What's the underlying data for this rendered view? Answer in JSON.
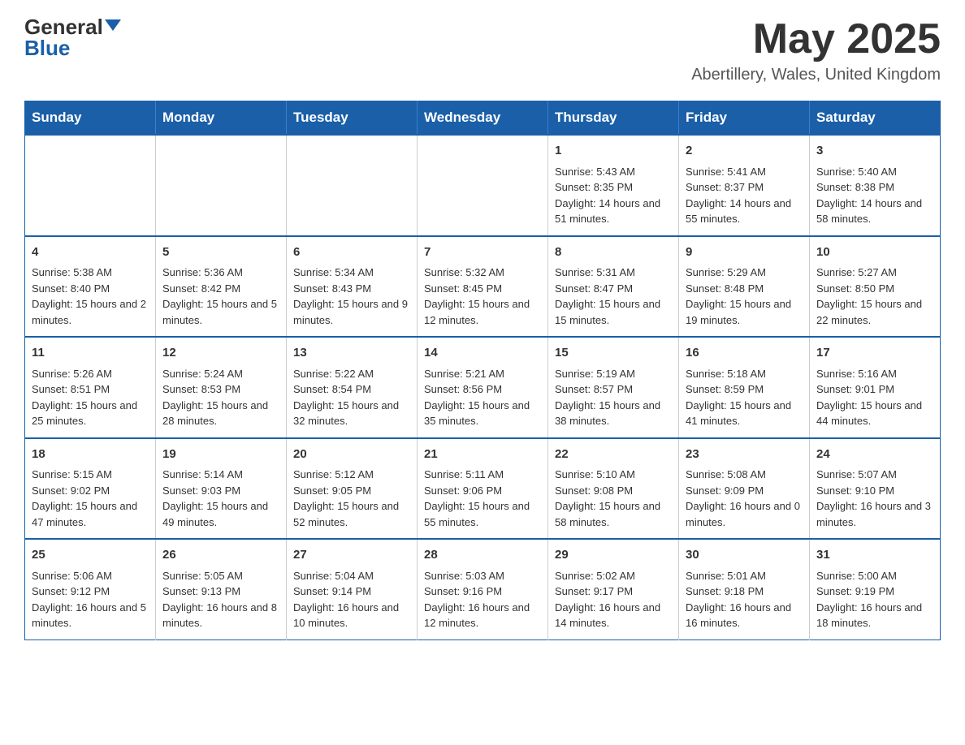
{
  "logo": {
    "general": "General",
    "blue": "Blue"
  },
  "title": "May 2025",
  "location": "Abertillery, Wales, United Kingdom",
  "days_of_week": [
    "Sunday",
    "Monday",
    "Tuesday",
    "Wednesday",
    "Thursday",
    "Friday",
    "Saturday"
  ],
  "weeks": [
    [
      {
        "day": "",
        "info": ""
      },
      {
        "day": "",
        "info": ""
      },
      {
        "day": "",
        "info": ""
      },
      {
        "day": "",
        "info": ""
      },
      {
        "day": "1",
        "info": "Sunrise: 5:43 AM\nSunset: 8:35 PM\nDaylight: 14 hours and 51 minutes."
      },
      {
        "day": "2",
        "info": "Sunrise: 5:41 AM\nSunset: 8:37 PM\nDaylight: 14 hours and 55 minutes."
      },
      {
        "day": "3",
        "info": "Sunrise: 5:40 AM\nSunset: 8:38 PM\nDaylight: 14 hours and 58 minutes."
      }
    ],
    [
      {
        "day": "4",
        "info": "Sunrise: 5:38 AM\nSunset: 8:40 PM\nDaylight: 15 hours and 2 minutes."
      },
      {
        "day": "5",
        "info": "Sunrise: 5:36 AM\nSunset: 8:42 PM\nDaylight: 15 hours and 5 minutes."
      },
      {
        "day": "6",
        "info": "Sunrise: 5:34 AM\nSunset: 8:43 PM\nDaylight: 15 hours and 9 minutes."
      },
      {
        "day": "7",
        "info": "Sunrise: 5:32 AM\nSunset: 8:45 PM\nDaylight: 15 hours and 12 minutes."
      },
      {
        "day": "8",
        "info": "Sunrise: 5:31 AM\nSunset: 8:47 PM\nDaylight: 15 hours and 15 minutes."
      },
      {
        "day": "9",
        "info": "Sunrise: 5:29 AM\nSunset: 8:48 PM\nDaylight: 15 hours and 19 minutes."
      },
      {
        "day": "10",
        "info": "Sunrise: 5:27 AM\nSunset: 8:50 PM\nDaylight: 15 hours and 22 minutes."
      }
    ],
    [
      {
        "day": "11",
        "info": "Sunrise: 5:26 AM\nSunset: 8:51 PM\nDaylight: 15 hours and 25 minutes."
      },
      {
        "day": "12",
        "info": "Sunrise: 5:24 AM\nSunset: 8:53 PM\nDaylight: 15 hours and 28 minutes."
      },
      {
        "day": "13",
        "info": "Sunrise: 5:22 AM\nSunset: 8:54 PM\nDaylight: 15 hours and 32 minutes."
      },
      {
        "day": "14",
        "info": "Sunrise: 5:21 AM\nSunset: 8:56 PM\nDaylight: 15 hours and 35 minutes."
      },
      {
        "day": "15",
        "info": "Sunrise: 5:19 AM\nSunset: 8:57 PM\nDaylight: 15 hours and 38 minutes."
      },
      {
        "day": "16",
        "info": "Sunrise: 5:18 AM\nSunset: 8:59 PM\nDaylight: 15 hours and 41 minutes."
      },
      {
        "day": "17",
        "info": "Sunrise: 5:16 AM\nSunset: 9:01 PM\nDaylight: 15 hours and 44 minutes."
      }
    ],
    [
      {
        "day": "18",
        "info": "Sunrise: 5:15 AM\nSunset: 9:02 PM\nDaylight: 15 hours and 47 minutes."
      },
      {
        "day": "19",
        "info": "Sunrise: 5:14 AM\nSunset: 9:03 PM\nDaylight: 15 hours and 49 minutes."
      },
      {
        "day": "20",
        "info": "Sunrise: 5:12 AM\nSunset: 9:05 PM\nDaylight: 15 hours and 52 minutes."
      },
      {
        "day": "21",
        "info": "Sunrise: 5:11 AM\nSunset: 9:06 PM\nDaylight: 15 hours and 55 minutes."
      },
      {
        "day": "22",
        "info": "Sunrise: 5:10 AM\nSunset: 9:08 PM\nDaylight: 15 hours and 58 minutes."
      },
      {
        "day": "23",
        "info": "Sunrise: 5:08 AM\nSunset: 9:09 PM\nDaylight: 16 hours and 0 minutes."
      },
      {
        "day": "24",
        "info": "Sunrise: 5:07 AM\nSunset: 9:10 PM\nDaylight: 16 hours and 3 minutes."
      }
    ],
    [
      {
        "day": "25",
        "info": "Sunrise: 5:06 AM\nSunset: 9:12 PM\nDaylight: 16 hours and 5 minutes."
      },
      {
        "day": "26",
        "info": "Sunrise: 5:05 AM\nSunset: 9:13 PM\nDaylight: 16 hours and 8 minutes."
      },
      {
        "day": "27",
        "info": "Sunrise: 5:04 AM\nSunset: 9:14 PM\nDaylight: 16 hours and 10 minutes."
      },
      {
        "day": "28",
        "info": "Sunrise: 5:03 AM\nSunset: 9:16 PM\nDaylight: 16 hours and 12 minutes."
      },
      {
        "day": "29",
        "info": "Sunrise: 5:02 AM\nSunset: 9:17 PM\nDaylight: 16 hours and 14 minutes."
      },
      {
        "day": "30",
        "info": "Sunrise: 5:01 AM\nSunset: 9:18 PM\nDaylight: 16 hours and 16 minutes."
      },
      {
        "day": "31",
        "info": "Sunrise: 5:00 AM\nSunset: 9:19 PM\nDaylight: 16 hours and 18 minutes."
      }
    ]
  ]
}
